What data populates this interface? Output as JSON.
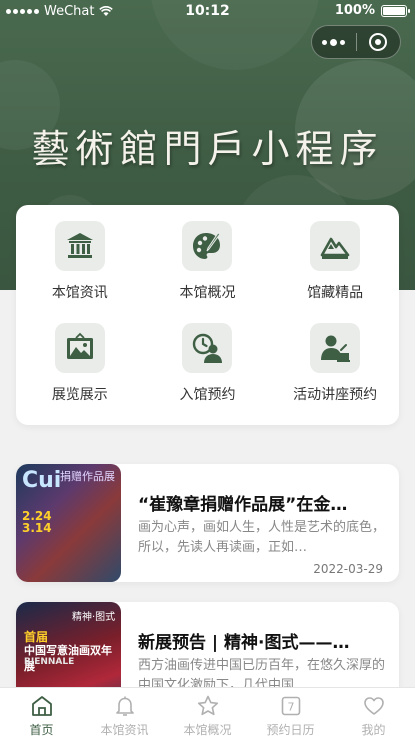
{
  "status_bar": {
    "carrier": "WeChat",
    "time": "10:12",
    "battery": "100%",
    "battery_level": 1.0
  },
  "header": {
    "title": "藝術館門戶小程序"
  },
  "colors": {
    "primary": "#3f5f45",
    "icon_bg": "#e9ece9",
    "background": "#f1f1f1"
  },
  "grid": [
    {
      "label": "本馆资讯",
      "icon": "museum-building-icon"
    },
    {
      "label": "本馆概况",
      "icon": "palette-brush-icon"
    },
    {
      "label": "馆藏精品",
      "icon": "mountain-picture-icon"
    },
    {
      "label": "展览展示",
      "icon": "framed-landscape-icon"
    },
    {
      "label": "入馆预约",
      "icon": "clock-person-icon"
    },
    {
      "label": "活动讲座预约",
      "icon": "lecture-person-icon"
    }
  ],
  "articles": [
    {
      "title": "“崔豫章捐赠作品展”在金…",
      "desc": "画为心声，画如人生，人性是艺术的底色，所以，先读人再读画，正如…",
      "date": "2022-03-29",
      "thumb": {
        "big": "Cui",
        "dates": "2.24\n3.14",
        "side": "捐赠作品展"
      }
    },
    {
      "title": "新展预告 | 精神·图式——…",
      "desc": "西方油画传进中国已历百年，在悠久深厚的中国文化激励下，几代中国…",
      "date": "",
      "thumb": {
        "top": "首届",
        "mid": "中国写意油画双年展",
        "en": "BIENNALE",
        "right": "精神·图式"
      }
    }
  ],
  "tabbar": [
    {
      "label": "首页",
      "icon": "home-icon",
      "active": true
    },
    {
      "label": "本馆资讯",
      "icon": "bell-icon",
      "active": false
    },
    {
      "label": "本馆概况",
      "icon": "star-icon",
      "active": false
    },
    {
      "label": "预约日历",
      "icon": "calendar-icon",
      "active": false
    },
    {
      "label": "我的",
      "icon": "heart-icon",
      "active": false
    }
  ]
}
